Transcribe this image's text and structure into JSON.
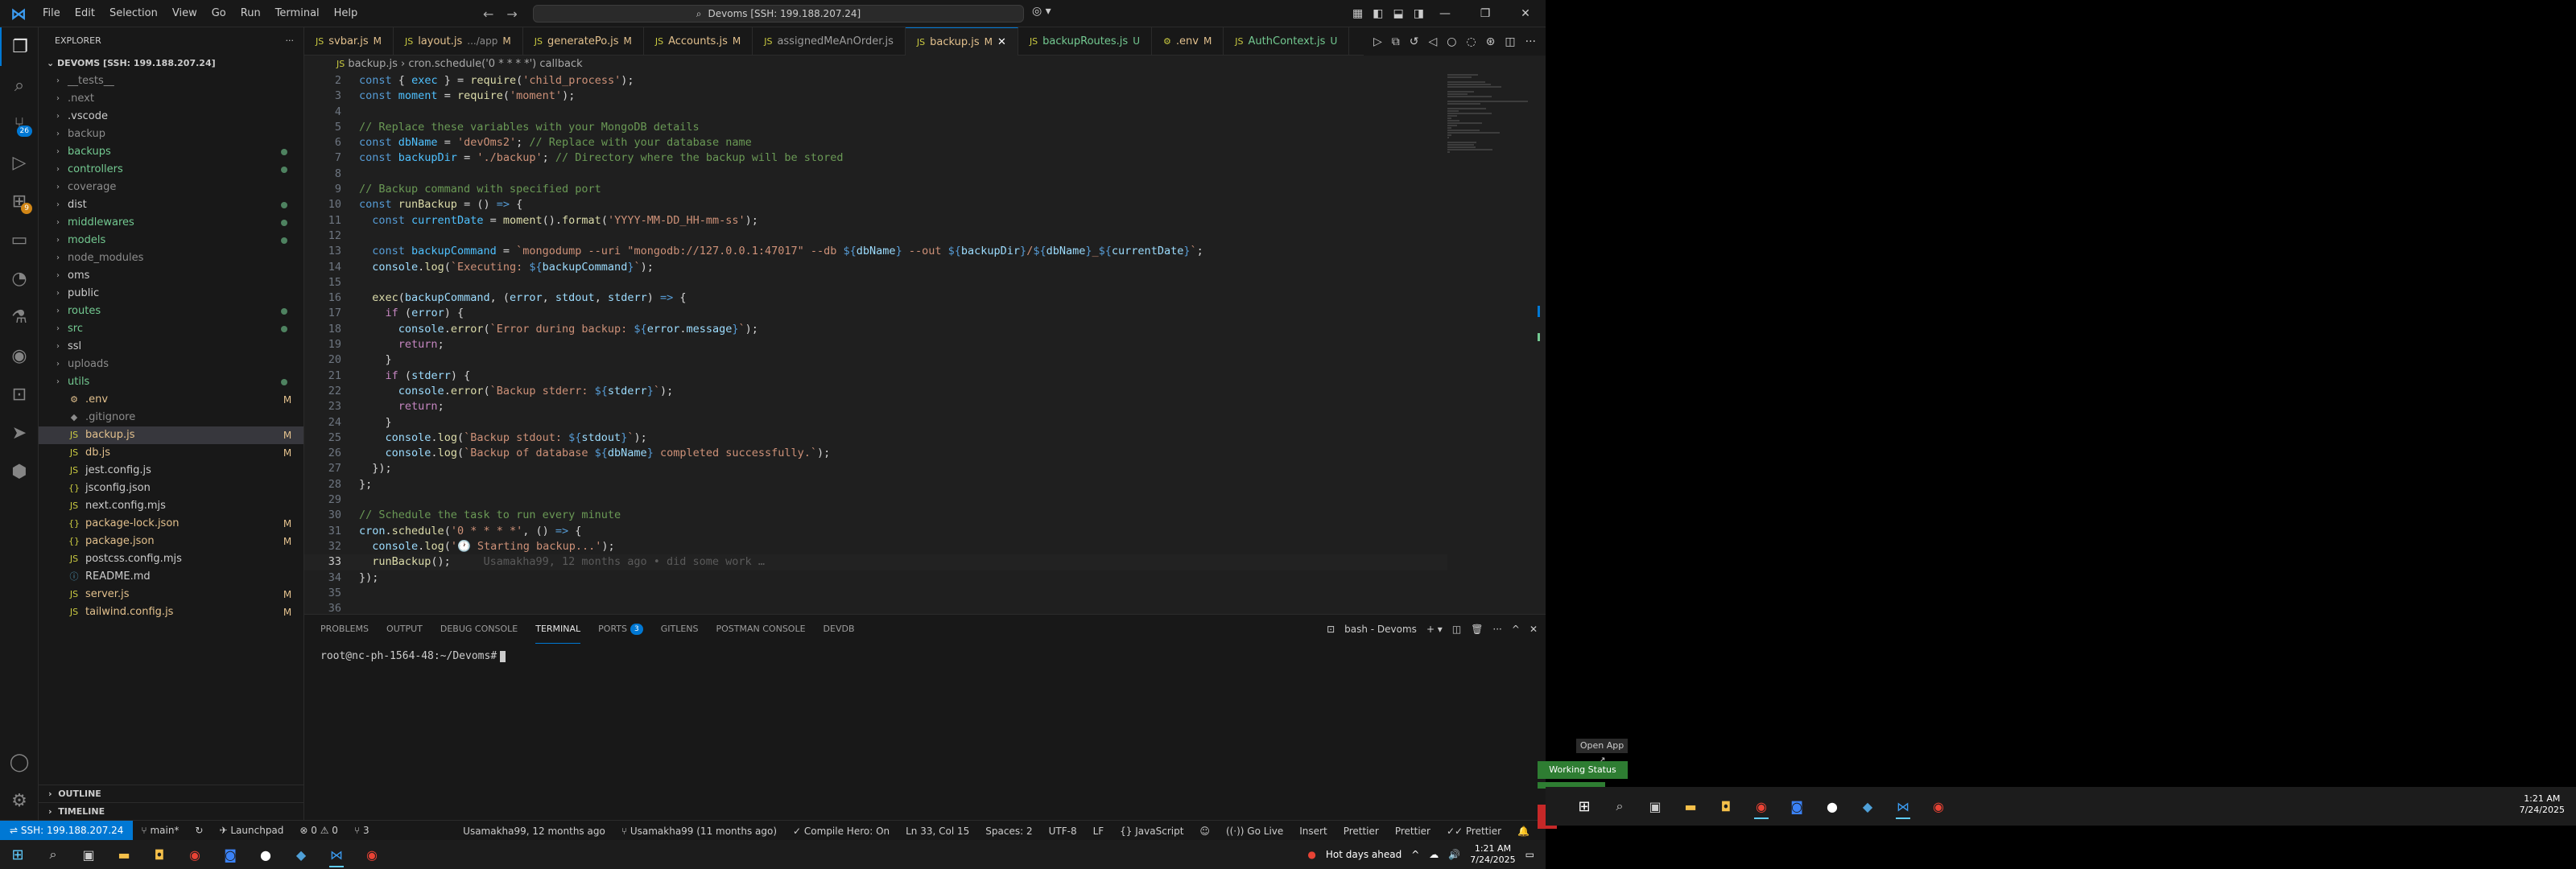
{
  "menu": [
    "File",
    "Edit",
    "Selection",
    "View",
    "Go",
    "Run",
    "Terminal",
    "Help"
  ],
  "command_center": "Devoms [SSH: 199.188.207.24]",
  "sidebar": {
    "header": "EXPLORER",
    "folder": "DEVOMS [SSH: 199.188.207.24]",
    "items": [
      {
        "label": "__tests__",
        "type": "folder",
        "status": "",
        "color": "dim"
      },
      {
        "label": ".next",
        "type": "folder",
        "status": "",
        "color": "dim"
      },
      {
        "label": ".vscode",
        "type": "folder",
        "status": "",
        "color": "default"
      },
      {
        "label": "backup",
        "type": "folder",
        "status": "",
        "color": "dim"
      },
      {
        "label": "backups",
        "type": "folder",
        "status": "dot",
        "color": "untracked"
      },
      {
        "label": "controllers",
        "type": "folder",
        "status": "dot",
        "color": "untracked"
      },
      {
        "label": "coverage",
        "type": "folder",
        "status": "",
        "color": "dim"
      },
      {
        "label": "dist",
        "type": "folder",
        "status": "dot",
        "color": "default"
      },
      {
        "label": "middlewares",
        "type": "folder",
        "status": "dot",
        "color": "untracked"
      },
      {
        "label": "models",
        "type": "folder",
        "status": "dot",
        "color": "untracked"
      },
      {
        "label": "node_modules",
        "type": "folder",
        "status": "",
        "color": "dim"
      },
      {
        "label": "oms",
        "type": "folder",
        "status": "",
        "color": "default"
      },
      {
        "label": "public",
        "type": "folder",
        "status": "",
        "color": "default"
      },
      {
        "label": "routes",
        "type": "folder",
        "status": "dot",
        "color": "untracked"
      },
      {
        "label": "src",
        "type": "folder",
        "status": "dot",
        "color": "untracked"
      },
      {
        "label": "ssl",
        "type": "folder",
        "status": "",
        "color": "default"
      },
      {
        "label": "uploads",
        "type": "folder",
        "status": "",
        "color": "dim"
      },
      {
        "label": "utils",
        "type": "folder",
        "status": "dot",
        "color": "untracked"
      },
      {
        "label": ".env",
        "type": "file",
        "status": "M",
        "color": "modified",
        "icon": "⚙"
      },
      {
        "label": ".gitignore",
        "type": "file",
        "status": "",
        "color": "dim",
        "icon": "◆"
      },
      {
        "label": "backup.js",
        "type": "file",
        "status": "M",
        "color": "modified",
        "icon": "JS",
        "selected": true
      },
      {
        "label": "db.js",
        "type": "file",
        "status": "M",
        "color": "modified",
        "icon": "JS"
      },
      {
        "label": "jest.config.js",
        "type": "file",
        "status": "",
        "color": "default",
        "icon": "JS"
      },
      {
        "label": "jsconfig.json",
        "type": "file",
        "status": "",
        "color": "default",
        "icon": "{}"
      },
      {
        "label": "next.config.mjs",
        "type": "file",
        "status": "",
        "color": "default",
        "icon": "JS"
      },
      {
        "label": "package-lock.json",
        "type": "file",
        "status": "M",
        "color": "modified",
        "icon": "{}"
      },
      {
        "label": "package.json",
        "type": "file",
        "status": "M",
        "color": "modified",
        "icon": "{}"
      },
      {
        "label": "postcss.config.mjs",
        "type": "file",
        "status": "",
        "color": "default",
        "icon": "JS"
      },
      {
        "label": "README.md",
        "type": "file",
        "status": "",
        "color": "default",
        "icon": "ⓘ"
      },
      {
        "label": "server.js",
        "type": "file",
        "status": "M",
        "color": "modified",
        "icon": "JS"
      },
      {
        "label": "tailwind.config.js",
        "type": "file",
        "status": "M",
        "color": "modified",
        "icon": "JS"
      }
    ],
    "outline": "OUTLINE",
    "timeline": "TIMELINE"
  },
  "tabs": [
    {
      "label": "svbar.js",
      "path": "",
      "status": "M",
      "active": false
    },
    {
      "label": "layout.js",
      "path": ".../app",
      "status": "M",
      "active": false
    },
    {
      "label": "generatePo.js",
      "path": "",
      "status": "M",
      "active": false
    },
    {
      "label": "Accounts.js",
      "path": "",
      "status": "M",
      "active": false
    },
    {
      "label": "assignedMeAnOrder.js",
      "path": "",
      "status": "",
      "active": false
    },
    {
      "label": "backup.js",
      "path": "",
      "status": "M",
      "active": true
    },
    {
      "label": "backupRoutes.js",
      "path": "",
      "status": "U",
      "active": false
    },
    {
      "label": ".env",
      "path": "",
      "status": "M",
      "active": false
    },
    {
      "label": "AuthContext.js",
      "path": "",
      "status": "U",
      "active": false
    }
  ],
  "breadcrumbs": [
    "backup.js",
    "cron.schedule('0 * * * *') callback"
  ],
  "code": {
    "current_line": "33",
    "lines": [
      {
        "n": "2",
        "html": "<span class='k'>const</span> <span class='p'>{</span> <span class='cv'>exec</span> <span class='p'>} =</span> <span class='f'>require</span><span class='p'>(</span><span class='s'>'child_process'</span><span class='p'>);</span>"
      },
      {
        "n": "3",
        "html": "<span class='k'>const</span> <span class='cv'>moment</span> <span class='p'>=</span> <span class='f'>require</span><span class='p'>(</span><span class='s'>'moment'</span><span class='p'>);</span>"
      },
      {
        "n": "4",
        "html": ""
      },
      {
        "n": "5",
        "html": "<span class='c'>// Replace these variables with your MongoDB details</span>"
      },
      {
        "n": "6",
        "html": "<span class='k'>const</span> <span class='cv'>dbName</span> <span class='p'>=</span> <span class='s'>'devOms2'</span><span class='p'>;</span> <span class='c'>// Replace with your database name</span>"
      },
      {
        "n": "7",
        "html": "<span class='k'>const</span> <span class='cv'>backupDir</span> <span class='p'>=</span> <span class='s'>'./backup'</span><span class='p'>;</span> <span class='c'>// Directory where the backup will be stored</span>"
      },
      {
        "n": "8",
        "html": ""
      },
      {
        "n": "9",
        "html": "<span class='c'>// Backup command with specified port</span>"
      },
      {
        "n": "10",
        "html": "<span class='k'>const</span> <span class='f'>runBackup</span> <span class='p'>= () </span><span class='k'>=&gt;</span> <span class='p'>{</span>"
      },
      {
        "n": "11",
        "html": "  <span class='k'>const</span> <span class='cv'>currentDate</span> <span class='p'>=</span> <span class='f'>moment</span><span class='p'>().</span><span class='f'>format</span><span class='p'>(</span><span class='s'>'YYYY-MM-DD_HH-mm-ss'</span><span class='p'>);</span>"
      },
      {
        "n": "12",
        "html": ""
      },
      {
        "n": "13",
        "html": "  <span class='k'>const</span> <span class='cv'>backupCommand</span> <span class='p'>=</span> <span class='s'>`mongodump --uri \"mongodb://127.0.0.1:47017\" --db </span><span class='k'>${</span><span class='v'>dbName</span><span class='k'>}</span><span class='s'> --out </span><span class='k'>${</span><span class='v'>backupDir</span><span class='k'>}</span><span class='s'>/</span><span class='k'>${</span><span class='v'>dbName</span><span class='k'>}</span><span class='s'>_</span><span class='k'>${</span><span class='v'>currentDate</span><span class='k'>}</span><span class='s'>`</span><span class='p'>;</span>"
      },
      {
        "n": "14",
        "html": "  <span class='v'>console</span><span class='p'>.</span><span class='f'>log</span><span class='p'>(</span><span class='s'>`Executing: </span><span class='k'>${</span><span class='v'>backupCommand</span><span class='k'>}</span><span class='s'>`</span><span class='p'>);</span>"
      },
      {
        "n": "15",
        "html": ""
      },
      {
        "n": "16",
        "html": "  <span class='f'>exec</span><span class='p'>(</span><span class='v'>backupCommand</span><span class='p'>, (</span><span class='v'>error</span><span class='p'>,</span> <span class='v'>stdout</span><span class='p'>,</span> <span class='v'>stderr</span><span class='p'>) </span><span class='k'>=&gt;</span> <span class='p'>{</span>"
      },
      {
        "n": "17",
        "html": "    <span class='kf'>if</span> <span class='p'>(</span><span class='v'>error</span><span class='p'>) {</span>"
      },
      {
        "n": "18",
        "html": "      <span class='v'>console</span><span class='p'>.</span><span class='f'>error</span><span class='p'>(</span><span class='s'>`Error during backup: </span><span class='k'>${</span><span class='v'>error</span><span class='p'>.</span><span class='v'>message</span><span class='k'>}</span><span class='s'>`</span><span class='p'>);</span>"
      },
      {
        "n": "19",
        "html": "      <span class='kf'>return</span><span class='p'>;</span>"
      },
      {
        "n": "20",
        "html": "    <span class='p'>}</span>"
      },
      {
        "n": "21",
        "html": "    <span class='kf'>if</span> <span class='p'>(</span><span class='v'>stderr</span><span class='p'>) {</span>"
      },
      {
        "n": "22",
        "html": "      <span class='v'>console</span><span class='p'>.</span><span class='f'>error</span><span class='p'>(</span><span class='s'>`Backup stderr: </span><span class='k'>${</span><span class='v'>stderr</span><span class='k'>}</span><span class='s'>`</span><span class='p'>);</span>"
      },
      {
        "n": "23",
        "html": "      <span class='kf'>return</span><span class='p'>;</span>"
      },
      {
        "n": "24",
        "html": "    <span class='p'>}</span>"
      },
      {
        "n": "25",
        "html": "    <span class='v'>console</span><span class='p'>.</span><span class='f'>log</span><span class='p'>(</span><span class='s'>`Backup stdout: </span><span class='k'>${</span><span class='v'>stdout</span><span class='k'>}</span><span class='s'>`</span><span class='p'>);</span>"
      },
      {
        "n": "26",
        "html": "    <span class='v'>console</span><span class='p'>.</span><span class='f'>log</span><span class='p'>(</span><span class='s'>`Backup of database </span><span class='k'>${</span><span class='v'>dbName</span><span class='k'>}</span><span class='s'> completed successfully.`</span><span class='p'>);</span>"
      },
      {
        "n": "27",
        "html": "  <span class='p'>});</span>"
      },
      {
        "n": "28",
        "html": "<span class='p'>};</span>"
      },
      {
        "n": "29",
        "html": ""
      },
      {
        "n": "30",
        "html": "<span class='c'>// Schedule the task to run every minute</span>"
      },
      {
        "n": "31",
        "html": "<span class='v'>cron</span><span class='p'>.</span><span class='f'>schedule</span><span class='p'>(</span><span class='s'>'0 * * * *'</span><span class='p'>, () </span><span class='k'>=&gt;</span> <span class='p'>{</span>"
      },
      {
        "n": "32",
        "html": "  <span class='v'>console</span><span class='p'>.</span><span class='f'>log</span><span class='p'>(</span><span class='s'>'🕐 Starting backup...'</span><span class='p'>);</span>"
      },
      {
        "n": "33",
        "html": "  <span class='f'>runBackup</span><span class='p'>();</span>     <span class='blame'>Usamakha99, 12 months ago • did some work …</span>"
      },
      {
        "n": "34",
        "html": "<span class='p'>});</span>"
      },
      {
        "n": "35",
        "html": ""
      },
      {
        "n": "36",
        "html": ""
      }
    ]
  },
  "panel": {
    "tabs": [
      {
        "label": "PROBLEMS",
        "badge": "",
        "active": false
      },
      {
        "label": "OUTPUT",
        "badge": "",
        "active": false
      },
      {
        "label": "DEBUG CONSOLE",
        "badge": "",
        "active": false
      },
      {
        "label": "TERMINAL",
        "badge": "",
        "active": true
      },
      {
        "label": "PORTS",
        "badge": "3",
        "active": false
      },
      {
        "label": "GITLENS",
        "badge": "",
        "active": false
      },
      {
        "label": "POSTMAN CONSOLE",
        "badge": "",
        "active": false
      },
      {
        "label": "DEVDB",
        "badge": "",
        "active": false
      }
    ],
    "terminal_name": "bash - Devoms",
    "prompt": "root@nc-ph-1564-48:~/Devoms#"
  },
  "status": {
    "remote": "SSH: 199.188.207.24",
    "branch": "main*",
    "launchpad": "Launchpad",
    "problems": "⊗ 0  ⚠ 0",
    "ports": "3",
    "blame1": "Usamakha99, 12 months ago",
    "blame2": "Usamakha99 (11 months ago)",
    "compile_hero": "Compile Hero: On",
    "position": "Ln 33, Col 15",
    "spaces": "Spaces: 2",
    "encoding": "UTF-8",
    "eol": "LF",
    "language": "JavaScript",
    "golive": "Go Live",
    "insert": "Insert",
    "prettier1": "Prettier",
    "prettier2": "Prettier",
    "prettier3": "Prettier"
  },
  "taskbar": {
    "weather": "Hot days ahead",
    "time": "1:21 AM",
    "date": "7/24/2025"
  },
  "right_display": {
    "open_app": "Open App ↗",
    "working_status": "Working Status Active",
    "time": "1:21 AM",
    "date": "7/24/2025"
  },
  "colors": {
    "accent": "#0078d4",
    "modified": "#e2c08d",
    "untracked": "#73c991",
    "working": "#2e7d32"
  }
}
